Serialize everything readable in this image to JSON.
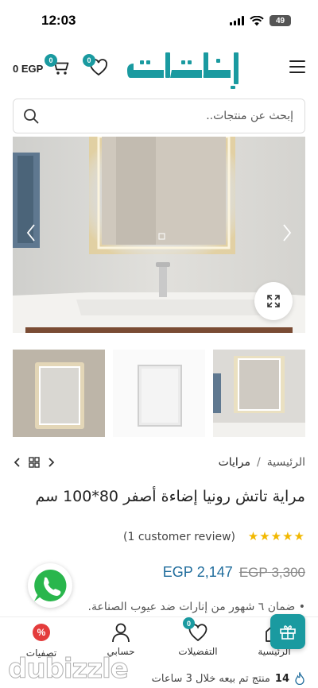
{
  "status_bar": {
    "time": "12:03",
    "battery": "49"
  },
  "header": {
    "cart_total": "0 EGP",
    "cart_count": "0",
    "wishlist_count": "0",
    "logo_text": "إنارات"
  },
  "search": {
    "placeholder": "إبحث عن منتجات.."
  },
  "breadcrumb": {
    "home": "الرئيسية",
    "separator": "/",
    "current": "مرايات"
  },
  "product": {
    "title": "مراية تاتش رونيا إضاءة أصفر 80*100 سم",
    "rating_stars": 5,
    "reviews_text": "(1 customer review)",
    "price_old": "3,300 EGP",
    "price_new": "2,147 EGP",
    "warranty": "• ضمان ٦ شهور من إنارات ضد عيوب الصناعة."
  },
  "bottom_nav": {
    "home": "الرئيسية",
    "favorites": "التفضيلات",
    "favorites_count": "0",
    "account": "حسابي",
    "offers": "تصفيات",
    "offers_symbol": "%"
  },
  "sales_banner": {
    "count": "14",
    "text": "منتج تم بيعه خلال 3 ساعات"
  },
  "watermark": "dubizzle",
  "colors": {
    "brand": "#1a9aa0",
    "price": "#1f6c9c",
    "stars": "#f2b800",
    "sale": "#e43c3c"
  }
}
